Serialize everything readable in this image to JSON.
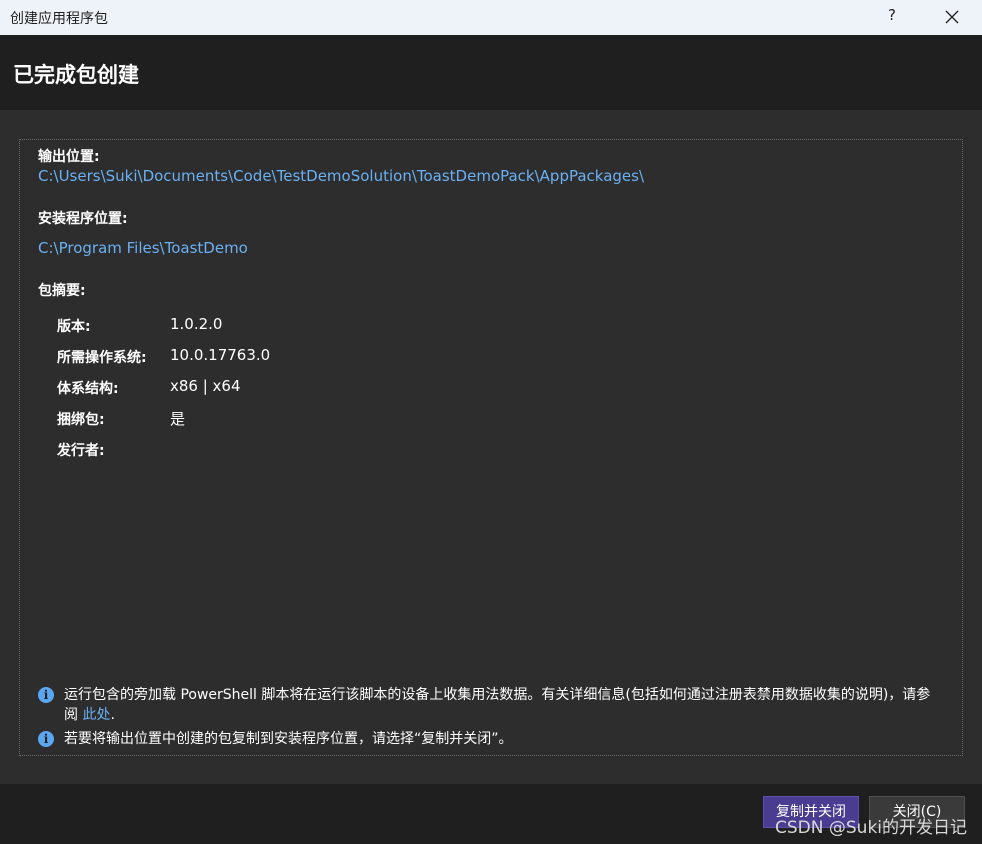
{
  "window": {
    "title": "创建应用程序包",
    "help_label": "?",
    "close_icon": "close-icon"
  },
  "header": {
    "title": "已完成包创建"
  },
  "output": {
    "label": "输出位置:",
    "path": "C:\\Users\\Suki\\Documents\\Code\\TestDemoSolution\\ToastDemoPack\\AppPackages\\"
  },
  "install": {
    "label": "安装程序位置:",
    "path": "C:\\Program Files\\ToastDemo"
  },
  "summary": {
    "label": "包摘要:",
    "rows": [
      {
        "label": "版本:",
        "value": "1.0.2.0"
      },
      {
        "label": "所需操作系统:",
        "value": "10.0.17763.0"
      },
      {
        "label": "体系结构:",
        "value": "x86 | x64"
      },
      {
        "label": "捆绑包:",
        "value": "是"
      },
      {
        "label": "发行者:",
        "value": ""
      }
    ]
  },
  "notices": {
    "telemetry_text": "运行包含的旁加载 PowerShell 脚本将在运行该脚本的设备上收集用法数据。有关详细信息(包括如何通过注册表禁用数据收集的说明)，请参阅 ",
    "telemetry_link": "此处",
    "telemetry_end": ".",
    "copy_text": "若要将输出位置中创建的包复制到安装程序位置，请选择“复制并关闭”。"
  },
  "footer": {
    "copy_close_label": "复制并关闭",
    "close_label": "关闭(C)"
  },
  "watermark": "CSDN @Suki的开发日记",
  "colors": {
    "accent": "#4a3d91",
    "link": "#6ab0f3",
    "background": "#2d2d2d"
  }
}
